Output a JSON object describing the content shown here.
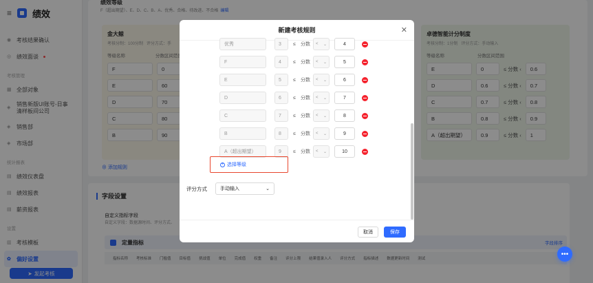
{
  "app": {
    "title": "绩效"
  },
  "sidebar": {
    "items": [
      {
        "label": "考核结果确认"
      },
      {
        "label": "绩效面谈"
      }
    ],
    "section_assess": "考核管理",
    "assess_items": [
      {
        "label": "全部对象"
      },
      {
        "label": "销售新版UI账号-日事清样板间公司"
      },
      {
        "label": "销售部"
      },
      {
        "label": "市场部"
      }
    ],
    "section_report": "统计报表",
    "report_items": [
      {
        "label": "绩效仪表盘"
      },
      {
        "label": "绩效报表"
      },
      {
        "label": "薪资报表"
      }
    ],
    "section_settings": "设置",
    "settings_items": [
      {
        "label": "考核模板"
      },
      {
        "label": "偏好设置"
      }
    ],
    "start_button": "发起考核"
  },
  "background": {
    "grade_header": "绩效等级",
    "grade_desc": "F（超出期望）、E、D、C、B、A、优秀、合格、待改进、不合格",
    "grade_edit": "编辑",
    "left_panel": {
      "title": "金大鲸",
      "sub1": "考核分制：100分制",
      "sub2": "评分方式：手"
    },
    "right_panel": {
      "title": "卓德智能计分制度",
      "sub1": "考核分制：1分制",
      "sub2": "评分方式：手动输入"
    },
    "col_name": "等级名称",
    "col_range": "分数区间范围",
    "left_rows": [
      {
        "name": "F",
        "score": "0"
      },
      {
        "name": "E",
        "score": "60"
      },
      {
        "name": "D",
        "score": "70"
      },
      {
        "name": "C",
        "score": "80"
      },
      {
        "name": "B",
        "score": "90"
      }
    ],
    "right_rows": [
      {
        "name": "E",
        "min": "0",
        "max": "0.6"
      },
      {
        "name": "D",
        "min": "0.6",
        "max": "0.7"
      },
      {
        "name": "C",
        "min": "0.7",
        "max": "0.8"
      },
      {
        "name": "B",
        "min": "0.8",
        "max": "0.9"
      },
      {
        "name": "A（超出期望）",
        "min": "0.9",
        "max": "1"
      }
    ],
    "score_word": "分数",
    "add_rule": "添加规则",
    "fields_title": "字段设置",
    "custom_title": "自定义指标字段",
    "custom_desc": "自定义字段：数据源时间、评分方式、",
    "quant_title": "定量指标",
    "field_sort": "字段排序",
    "chips": [
      "指标名称",
      "考核标准",
      "门槛值",
      "目标值",
      "挑战值",
      "单位",
      "完成值",
      "权重",
      "备注",
      "评分上限",
      "结果值录入人",
      "评分方式",
      "指标描述",
      "数据更新时间",
      "测试"
    ]
  },
  "modal": {
    "title": "新建考核规则",
    "score_word": "分数",
    "le_symbol": "≤",
    "rows": [
      {
        "name": "优秀",
        "min": "3",
        "op": "<",
        "max": "4"
      },
      {
        "name": "F",
        "min": "4",
        "op": "<",
        "max": "5"
      },
      {
        "name": "E",
        "min": "5",
        "op": "<",
        "max": "6"
      },
      {
        "name": "D",
        "min": "6",
        "op": "<",
        "max": "7"
      },
      {
        "name": "C",
        "min": "7",
        "op": "<",
        "max": "8"
      },
      {
        "name": "B",
        "min": "8",
        "op": "<",
        "max": "9"
      },
      {
        "name": "A（超出期望）",
        "min": "9",
        "op": "<",
        "max": "10"
      }
    ],
    "select_level": "选择等级",
    "score_method_label": "评分方式",
    "score_method_value": "手动输入",
    "cancel": "取消",
    "save": "保存"
  }
}
